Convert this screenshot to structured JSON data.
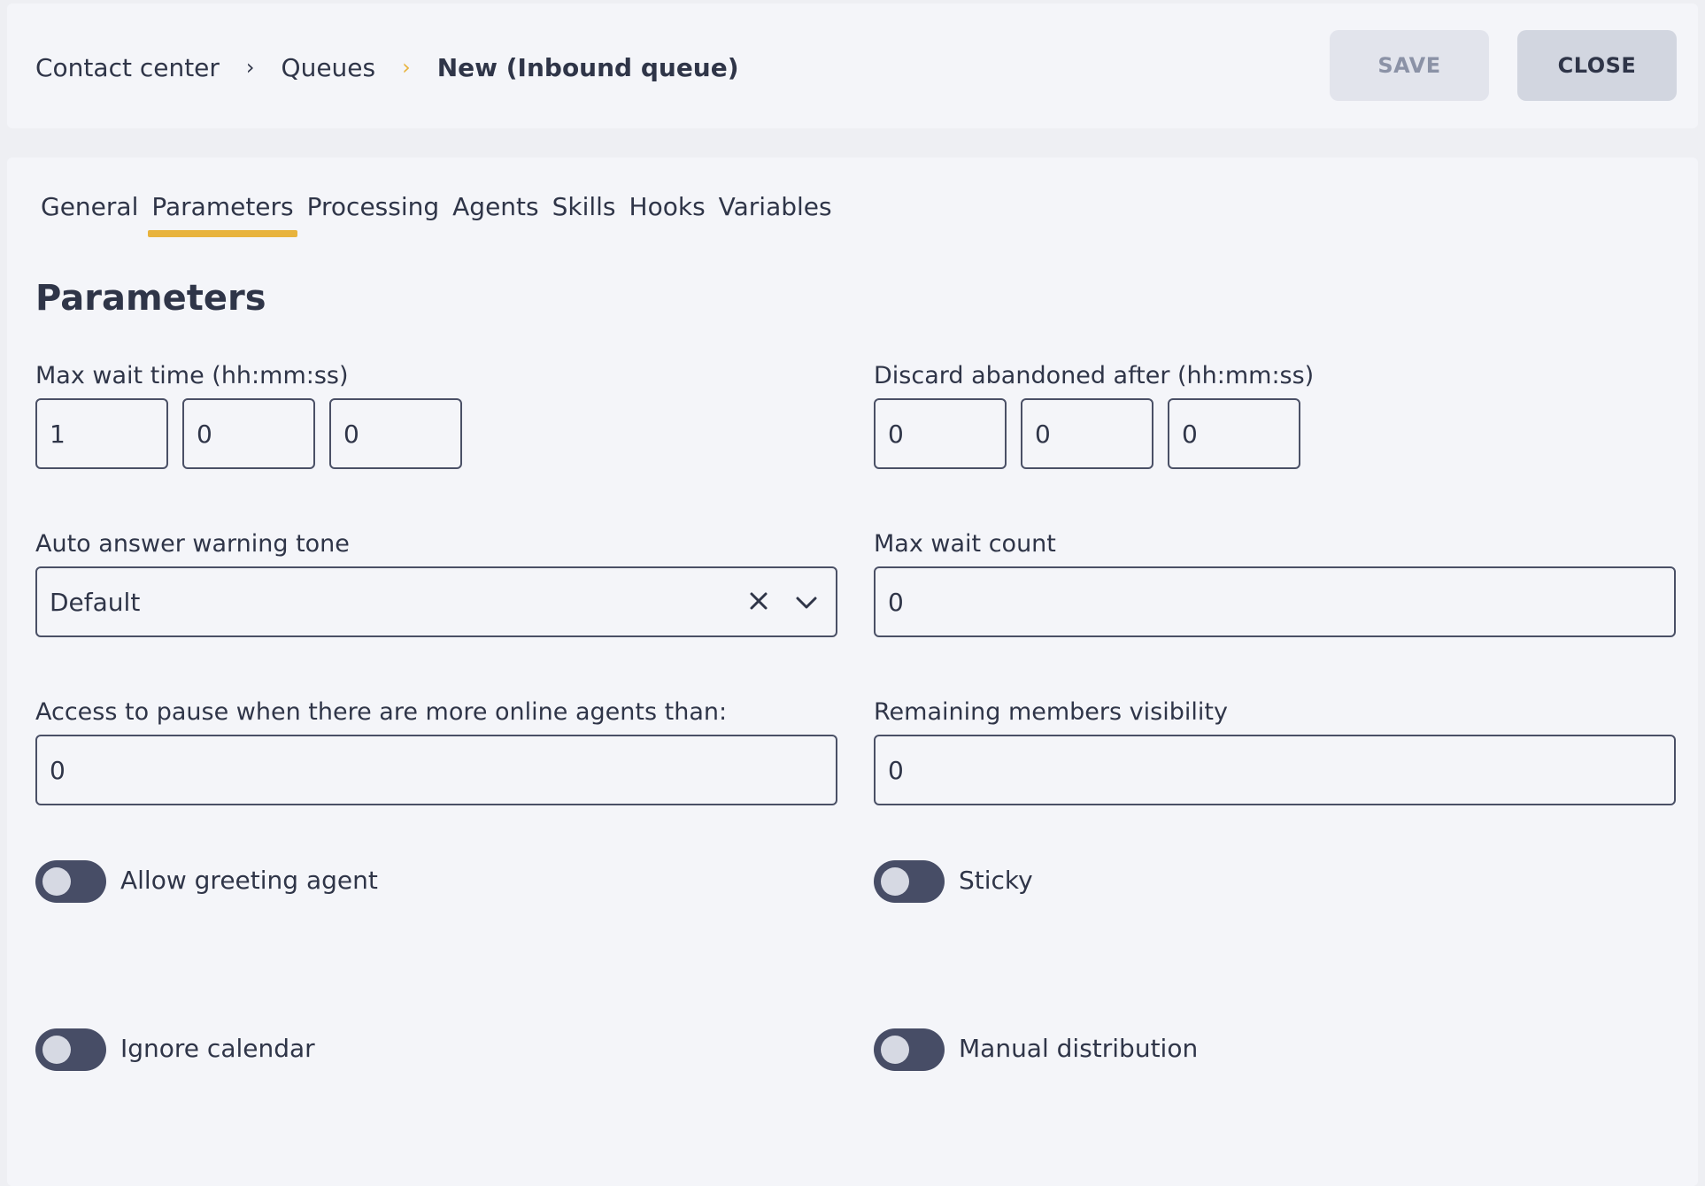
{
  "header": {
    "breadcrumb": [
      {
        "label": "Contact center"
      },
      {
        "label": "Queues"
      },
      {
        "label": "New (Inbound queue)"
      }
    ],
    "save_label": "SAVE",
    "close_label": "CLOSE"
  },
  "tabs": [
    {
      "label": "General"
    },
    {
      "label": "Parameters",
      "active": true
    },
    {
      "label": "Processing"
    },
    {
      "label": "Agents"
    },
    {
      "label": "Skills"
    },
    {
      "label": "Hooks"
    },
    {
      "label": "Variables"
    }
  ],
  "section_title": "Parameters",
  "fields": {
    "max_wait_time": {
      "label": "Max wait time (hh:mm:ss)",
      "hh": "1",
      "mm": "0",
      "ss": "0"
    },
    "discard_abandoned": {
      "label": "Discard abandoned after (hh:mm:ss)",
      "hh": "0",
      "mm": "0",
      "ss": "0"
    },
    "auto_answer_tone": {
      "label": "Auto answer warning tone",
      "value": "Default"
    },
    "max_wait_count": {
      "label": "Max wait count",
      "value": "0"
    },
    "access_to_pause": {
      "label": "Access to pause when there are more online agents than:",
      "value": "0"
    },
    "remaining_members": {
      "label": "Remaining members visibility",
      "value": "0"
    }
  },
  "toggles": {
    "allow_greeting_agent": {
      "label": "Allow greeting agent",
      "on": false
    },
    "sticky": {
      "label": "Sticky",
      "on": false
    },
    "ignore_calendar": {
      "label": "Ignore calendar",
      "on": false
    },
    "manual_distribution": {
      "label": "Manual distribution",
      "on": false
    }
  },
  "colors": {
    "accent": "#e8b33d",
    "text": "#2f3548",
    "toggle_off": "#474d66"
  }
}
